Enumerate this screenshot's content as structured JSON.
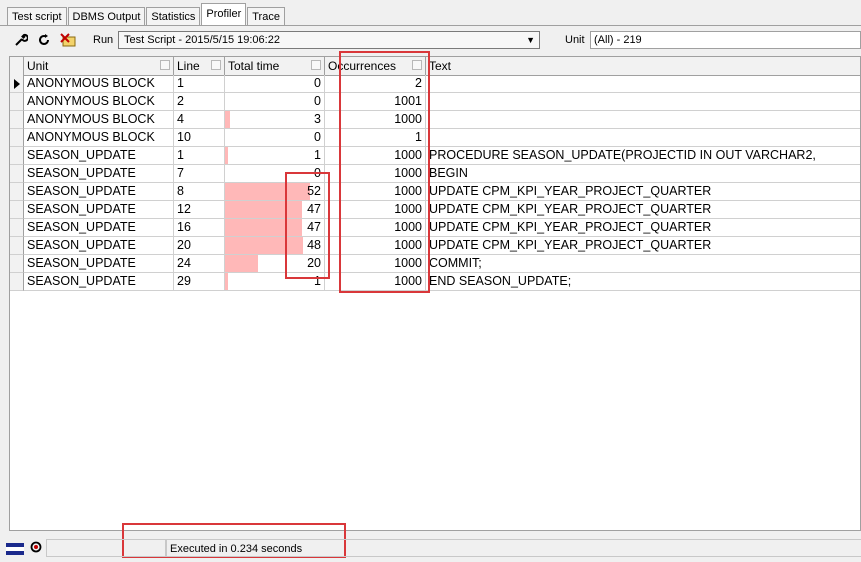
{
  "tabs": [
    {
      "label": "Test script",
      "active": false
    },
    {
      "label": "DBMS Output",
      "active": false
    },
    {
      "label": "Statistics",
      "active": false
    },
    {
      "label": "Profiler",
      "active": true
    },
    {
      "label": "Trace",
      "active": false
    }
  ],
  "toolbar": {
    "icons": [
      "wrench-icon",
      "refresh-icon",
      "clear-report-icon"
    ],
    "run_label": "Run",
    "run_value": "Test Script - 2015/5/15 19:06:22",
    "unit_label": "Unit",
    "unit_value": "(All) - 219"
  },
  "grid": {
    "columns": [
      "Unit",
      "Line",
      "Total time",
      "Occurrences",
      "Text"
    ],
    "max_time": 52,
    "rows": [
      {
        "unit": "ANONYMOUS BLOCK",
        "line": "1",
        "time": "0",
        "occ": "2",
        "text": ""
      },
      {
        "unit": "ANONYMOUS BLOCK",
        "line": "2",
        "time": "0",
        "occ": "1001",
        "text": ""
      },
      {
        "unit": "ANONYMOUS BLOCK",
        "line": "4",
        "time": "3",
        "occ": "1000",
        "text": ""
      },
      {
        "unit": "ANONYMOUS BLOCK",
        "line": "10",
        "time": "0",
        "occ": "1",
        "text": ""
      },
      {
        "unit": "SEASON_UPDATE",
        "line": "1",
        "time": "1",
        "occ": "1000",
        "text": "PROCEDURE SEASON_UPDATE(PROJECTID IN OUT VARCHAR2,"
      },
      {
        "unit": "SEASON_UPDATE",
        "line": "7",
        "time": "0",
        "occ": "1000",
        "text": "BEGIN"
      },
      {
        "unit": "SEASON_UPDATE",
        "line": "8",
        "time": "52",
        "occ": "1000",
        "text": "UPDATE CPM_KPI_YEAR_PROJECT_QUARTER"
      },
      {
        "unit": "SEASON_UPDATE",
        "line": "12",
        "time": "47",
        "occ": "1000",
        "text": "UPDATE CPM_KPI_YEAR_PROJECT_QUARTER"
      },
      {
        "unit": "SEASON_UPDATE",
        "line": "16",
        "time": "47",
        "occ": "1000",
        "text": "UPDATE CPM_KPI_YEAR_PROJECT_QUARTER"
      },
      {
        "unit": "SEASON_UPDATE",
        "line": "20",
        "time": "48",
        "occ": "1000",
        "text": "UPDATE CPM_KPI_YEAR_PROJECT_QUARTER"
      },
      {
        "unit": "SEASON_UPDATE",
        "line": "24",
        "time": "20",
        "occ": "1000",
        "text": "COMMIT;"
      },
      {
        "unit": "SEASON_UPDATE",
        "line": "29",
        "time": "1",
        "occ": "1000",
        "text": "END SEASON_UPDATE;"
      }
    ]
  },
  "status": {
    "text": "Executed in 0.234 seconds"
  },
  "colors": {
    "time_bar": "#ffb8b8",
    "highlight_box": "#d9373a"
  }
}
